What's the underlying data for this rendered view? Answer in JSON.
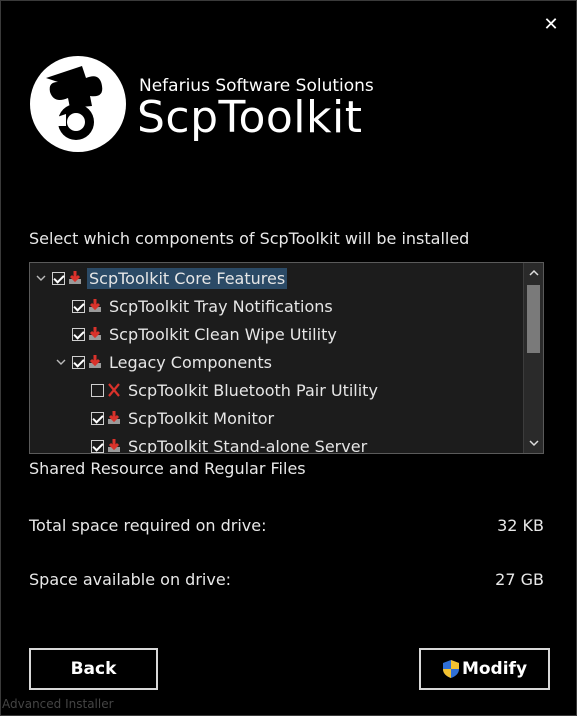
{
  "window": {
    "close_glyph": "✕"
  },
  "header": {
    "company": "Nefarius Software Solutions",
    "product": "ScpToolkit"
  },
  "instruction": "Select which components of ScpToolkit will be installed",
  "tree": {
    "items": [
      {
        "label": "ScpToolkit Core Features",
        "checked": true,
        "expanded": true,
        "state_icon": "install-icon"
      },
      {
        "label": "ScpToolkit Tray Notifications",
        "checked": true,
        "state_icon": "install-icon"
      },
      {
        "label": "ScpToolkit Clean Wipe Utility",
        "checked": true,
        "state_icon": "install-icon"
      },
      {
        "label": "Legacy Components",
        "checked": true,
        "expanded": true,
        "state_icon": "install-icon"
      },
      {
        "label": "ScpToolkit Bluetooth Pair Utility",
        "checked": false,
        "state_icon": "not-installed-icon"
      },
      {
        "label": "ScpToolkit Monitor",
        "checked": true,
        "state_icon": "install-icon"
      },
      {
        "label": "ScpToolkit Stand-alone Server",
        "checked": true,
        "state_icon": "install-icon"
      }
    ]
  },
  "description": "Shared Resource and Regular Files",
  "space": {
    "required_label": "Total space required on drive:",
    "required_value": "32 KB",
    "available_label": "Space available on drive:",
    "available_value": "27 GB"
  },
  "buttons": {
    "back": "Back",
    "modify": "Modify"
  },
  "footer": "Advanced Installer",
  "colors": {
    "background": "#000000",
    "selection": "#2b4a66",
    "install_icon": "#d9322b",
    "shield_blue": "#2f6fd6",
    "shield_yellow": "#f2c230"
  }
}
